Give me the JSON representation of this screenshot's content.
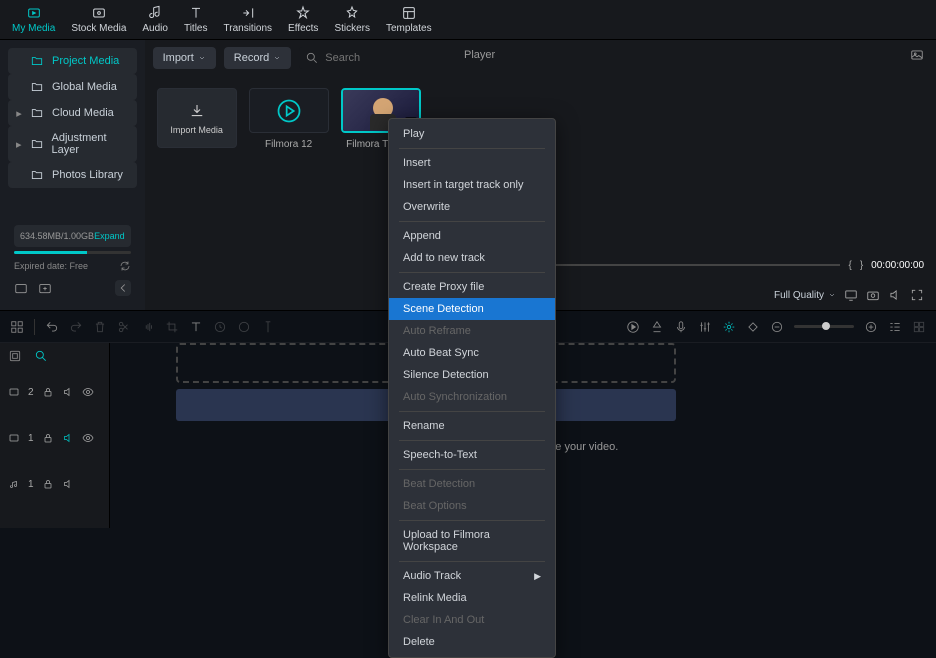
{
  "nav": {
    "items": [
      {
        "label": "My Media",
        "icon": "media"
      },
      {
        "label": "Stock Media",
        "icon": "stock"
      },
      {
        "label": "Audio",
        "icon": "audio"
      },
      {
        "label": "Titles",
        "icon": "titles"
      },
      {
        "label": "Transitions",
        "icon": "transitions"
      },
      {
        "label": "Effects",
        "icon": "effects"
      },
      {
        "label": "Stickers",
        "icon": "stickers"
      },
      {
        "label": "Templates",
        "icon": "templates"
      }
    ]
  },
  "sidebar": {
    "items": [
      {
        "label": "Project Media",
        "active": true
      },
      {
        "label": "Global Media"
      },
      {
        "label": "Cloud Media",
        "expand": true
      },
      {
        "label": "Adjustment Layer",
        "expand": true
      },
      {
        "label": "Photos Library"
      }
    ],
    "storage": "634.58MB/1.00GB",
    "expand_label": "Expand",
    "expired": "Expired date: Free"
  },
  "toolbar": {
    "import": "Import",
    "record": "Record",
    "search_placeholder": "Search"
  },
  "thumbs": [
    {
      "label": "Import Media",
      "type": "import"
    },
    {
      "label": "Filmora 12",
      "type": "circle"
    },
    {
      "label": "Filmora Tutorial",
      "type": "video",
      "selected": true
    }
  ],
  "player": {
    "title": "Player",
    "braces_l": "{",
    "braces_r": "}",
    "timecode": "00:00:00:00",
    "quality": "Full Quality"
  },
  "context_menu": {
    "items": [
      {
        "label": "Play"
      },
      {
        "sep": true
      },
      {
        "label": "Insert"
      },
      {
        "label": "Insert in target track only"
      },
      {
        "label": "Overwrite"
      },
      {
        "sep": true
      },
      {
        "label": "Append"
      },
      {
        "label": "Add to new track"
      },
      {
        "sep": true
      },
      {
        "label": "Create Proxy file"
      },
      {
        "label": "Scene Detection",
        "highlighted": true
      },
      {
        "label": "Auto Reframe",
        "disabled": true
      },
      {
        "label": "Auto Beat Sync"
      },
      {
        "label": "Silence Detection"
      },
      {
        "label": "Auto Synchronization",
        "disabled": true
      },
      {
        "sep": true
      },
      {
        "label": "Rename"
      },
      {
        "sep": true
      },
      {
        "label": "Speech-to-Text"
      },
      {
        "sep": true
      },
      {
        "label": "Beat Detection",
        "disabled": true
      },
      {
        "label": "Beat Options",
        "disabled": true
      },
      {
        "sep": true
      },
      {
        "label": "Upload to Filmora Workspace"
      },
      {
        "sep": true
      },
      {
        "label": "Audio Track",
        "submenu": true
      },
      {
        "label": "Relink Media"
      },
      {
        "label": "Clear In And Out",
        "disabled": true
      },
      {
        "label": "Delete"
      }
    ]
  },
  "tracks": [
    {
      "type": "video",
      "label": "2"
    },
    {
      "type": "video",
      "label": "1"
    },
    {
      "type": "audio",
      "label": "1"
    }
  ],
  "drop_text": "eate your video."
}
